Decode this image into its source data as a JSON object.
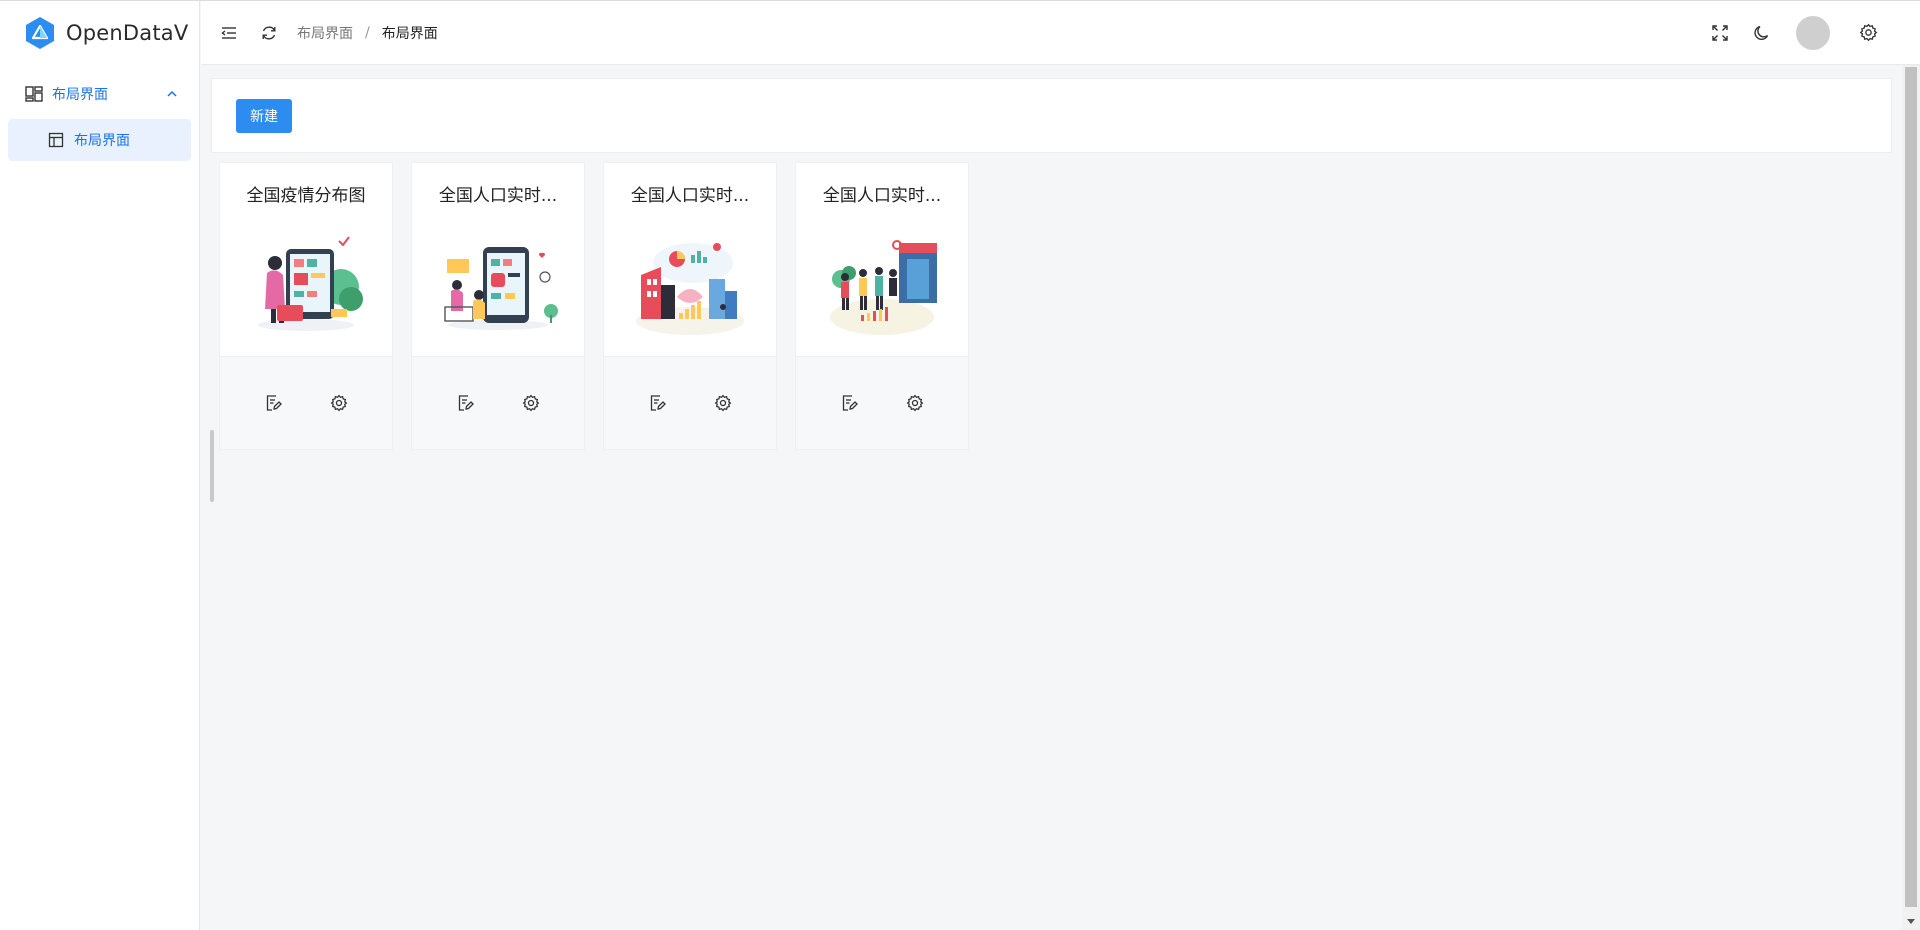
{
  "app": {
    "name": "OpenDataV"
  },
  "sidebar": {
    "group_label": "布局界面",
    "sub_items": [
      {
        "label": "布局界面"
      }
    ]
  },
  "header": {
    "breadcrumb": [
      "布局界面",
      "布局界面"
    ],
    "breadcrumb_separator": "/"
  },
  "toolbar": {
    "new_label": "新建"
  },
  "cards": [
    {
      "title": "全国疫情分布图"
    },
    {
      "title": "全国人口实时..."
    },
    {
      "title": "全国人口实时..."
    },
    {
      "title": "全国人口实时..."
    }
  ],
  "colors": {
    "accent": "#2d8cf0",
    "menu_active_bg": "#e8f1fd",
    "menu_text": "#1a73e8"
  }
}
